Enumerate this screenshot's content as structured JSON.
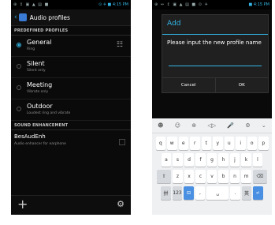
{
  "left": {
    "statusbar": {
      "icons": "⊕ ↕ ▣ ▲ ▤ ■",
      "right": "⊙ ✈ ■ 4:15",
      "suffix": "PM"
    },
    "actionbar": {
      "title": "Audio profiles"
    },
    "predefined_header": "PREDEFINED PROFILES",
    "profiles": [
      {
        "title": "General",
        "subtitle": "Ring",
        "selected": true
      },
      {
        "title": "Silent",
        "subtitle": "Silent only",
        "selected": false
      },
      {
        "title": "Meeting",
        "subtitle": "Vibrate only",
        "selected": false
      },
      {
        "title": "Outdoor",
        "subtitle": "Loudest ring and vibrate",
        "selected": false
      }
    ],
    "enh_header": "SOUND ENHANCEMENT",
    "enhancement": {
      "title": "BesAudEnh",
      "subtitle": "Audio enhancer for earphone"
    },
    "icons": {
      "settings": "settings-sliders-icon",
      "add": "add-icon",
      "gear": "gear-icon"
    }
  },
  "right": {
    "statusbar": {
      "icons": "⊕ ↔ ↕ ▣ ▲ ▤ ■ ⊙ ✈",
      "right": "■ 4:15",
      "suffix": "PM"
    },
    "dialog": {
      "title": "Add",
      "message": "Please input the new profile name",
      "cancel": "Cancel",
      "ok": "OK"
    },
    "keyboard": {
      "suggestions": [
        "☻",
        "☺",
        "⊕",
        "◁▷",
        "🎤",
        "⚙",
        "⌄"
      ],
      "row1": [
        "q",
        "w",
        "e",
        "r",
        "t",
        "y",
        "u",
        "i",
        "o",
        "p"
      ],
      "row2": [
        "a",
        "s",
        "d",
        "f",
        "g",
        "h",
        "j",
        "k",
        "l"
      ],
      "row3": [
        "⇧",
        "z",
        "x",
        "c",
        "v",
        "b",
        "n",
        "m",
        "⌫"
      ],
      "row4": [
        "拼",
        "123",
        "⊟",
        ",",
        "␣",
        ".",
        "英",
        "↵"
      ]
    }
  },
  "colors": {
    "accent": "#33b5e5",
    "background": "#0a0a0a"
  }
}
